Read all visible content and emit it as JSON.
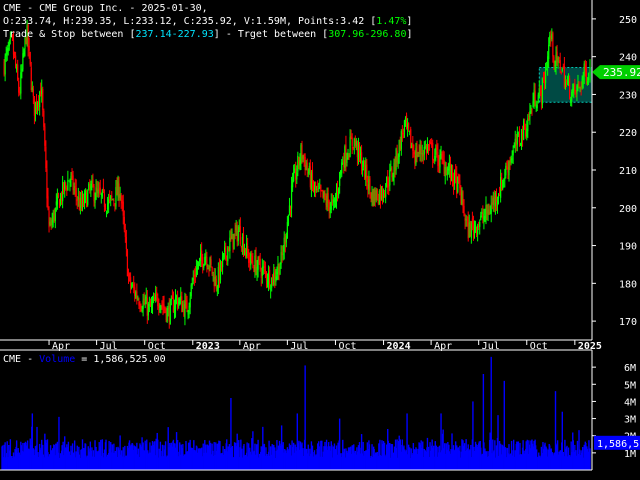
{
  "header": {
    "title": "CME - CME Group Inc. - 2025-01-30,",
    "ohlc": "O:233.74, H:239.35, L:233.12, C:235.92, V:1.59M, Points:3.42",
    "change_pct": "1.47%",
    "trade_stop_label": "Trade & Stop between",
    "trade_stop_range": "237.14-227.93",
    "target_label": "- Trget between",
    "target_range": "307.96-296.80"
  },
  "volume_header": {
    "ticker": "CME -",
    "series": "Volume",
    "value": "= 1,586,525.00"
  },
  "price_axis": {
    "ticks": [
      "250",
      "240",
      "230",
      "220",
      "210",
      "200",
      "190",
      "180",
      "170"
    ],
    "last_price_label": "235.92"
  },
  "volume_axis": {
    "ticks": [
      "6M",
      "5M",
      "4M",
      "3M",
      "2M",
      "1M"
    ],
    "last_volume_label": "1,586,5"
  },
  "time_axis": {
    "labels": [
      "Apr",
      "Jul",
      "Oct",
      "2023",
      "Apr",
      "Jul",
      "Oct",
      "2024",
      "Apr",
      "Jul",
      "Oct",
      "2025"
    ]
  },
  "colors": {
    "background": "#000000",
    "up": "#00ff00",
    "down": "#ff0000",
    "volume": "#0000ff",
    "zone_fill": "#004a44",
    "zone_border": "#00c8b4",
    "price_tag": "#00d000",
    "cyan": "#00e5ff",
    "green_text": "#00ff00",
    "grid_text": "#ffffff"
  },
  "chart_data": {
    "type": "candlestick",
    "x_range": [
      "2022-01-01",
      "2025-01-30"
    ],
    "y_range": [
      165,
      255
    ],
    "volume_range": [
      0,
      7000000
    ],
    "trend_closes": [
      [
        "2022-01-05",
        238
      ],
      [
        "2022-01-20",
        244
      ],
      [
        "2022-02-03",
        230
      ],
      [
        "2022-02-17",
        247
      ],
      [
        "2022-03-03",
        226
      ],
      [
        "2022-03-17",
        232
      ],
      [
        "2022-04-01",
        194
      ],
      [
        "2022-04-20",
        202
      ],
      [
        "2022-05-10",
        208
      ],
      [
        "2022-06-01",
        200
      ],
      [
        "2022-06-20",
        205
      ],
      [
        "2022-07-05",
        203
      ],
      [
        "2022-07-25",
        201
      ],
      [
        "2022-08-15",
        205
      ],
      [
        "2022-09-01",
        180
      ],
      [
        "2022-09-20",
        176
      ],
      [
        "2022-10-10",
        173
      ],
      [
        "2022-10-28",
        176
      ],
      [
        "2022-11-15",
        172
      ],
      [
        "2022-12-01",
        176
      ],
      [
        "2022-12-20",
        173
      ],
      [
        "2023-01-05",
        183
      ],
      [
        "2023-01-25",
        188
      ],
      [
        "2023-02-15",
        180
      ],
      [
        "2023-03-10",
        190
      ],
      [
        "2023-03-30",
        194
      ],
      [
        "2023-04-20",
        186
      ],
      [
        "2023-05-10",
        184
      ],
      [
        "2023-06-01",
        181
      ],
      [
        "2023-06-20",
        186
      ],
      [
        "2023-07-10",
        205
      ],
      [
        "2023-07-28",
        215
      ],
      [
        "2023-08-20",
        205
      ],
      [
        "2023-09-10",
        202
      ],
      [
        "2023-09-28",
        200
      ],
      [
        "2023-10-15",
        213
      ],
      [
        "2023-11-05",
        218
      ],
      [
        "2023-11-25",
        210
      ],
      [
        "2023-12-10",
        203
      ],
      [
        "2023-12-28",
        204
      ],
      [
        "2024-01-20",
        210
      ],
      [
        "2024-02-10",
        222
      ],
      [
        "2024-03-01",
        214
      ],
      [
        "2024-03-25",
        216
      ],
      [
        "2024-04-15",
        213
      ],
      [
        "2024-05-05",
        210
      ],
      [
        "2024-05-25",
        205
      ],
      [
        "2024-06-10",
        194
      ],
      [
        "2024-06-30",
        196
      ],
      [
        "2024-07-20",
        199
      ],
      [
        "2024-08-10",
        205
      ],
      [
        "2024-08-30",
        213
      ],
      [
        "2024-09-15",
        218
      ],
      [
        "2024-10-01",
        222
      ],
      [
        "2024-10-15",
        229
      ],
      [
        "2024-10-28",
        230
      ],
      [
        "2024-11-05",
        235
      ],
      [
        "2024-11-15",
        246
      ],
      [
        "2024-11-25",
        238
      ],
      [
        "2024-12-05",
        238
      ],
      [
        "2024-12-15",
        233
      ],
      [
        "2024-12-28",
        230
      ],
      [
        "2025-01-10",
        232
      ],
      [
        "2025-01-20",
        236
      ],
      [
        "2025-01-30",
        235.92
      ]
    ],
    "last": {
      "date": "2025-01-30",
      "open": 233.74,
      "high": 239.35,
      "low": 233.12,
      "close": 235.92,
      "volume": 1586525
    },
    "zone": {
      "start": "2024-10-25",
      "end": "2025-01-30",
      "top": 237.14,
      "bottom": 227.93
    },
    "volume_spikes": [
      [
        "2022-03-01",
        3300000
      ],
      [
        "2022-04-20",
        3100000
      ],
      [
        "2022-11-15",
        2500000
      ],
      [
        "2023-03-15",
        4200000
      ],
      [
        "2023-06-20",
        2600000
      ],
      [
        "2023-07-20",
        3300000
      ],
      [
        "2023-08-05",
        6100000
      ],
      [
        "2023-10-10",
        3000000
      ],
      [
        "2024-02-15",
        3300000
      ],
      [
        "2024-04-20",
        3300000
      ],
      [
        "2024-06-20",
        4000000
      ],
      [
        "2024-07-10",
        5600000
      ],
      [
        "2024-07-25",
        6600000
      ],
      [
        "2024-08-08",
        3200000
      ],
      [
        "2024-08-20",
        5200000
      ],
      [
        "2024-11-25",
        4600000
      ],
      [
        "2024-12-08",
        3400000
      ]
    ]
  }
}
